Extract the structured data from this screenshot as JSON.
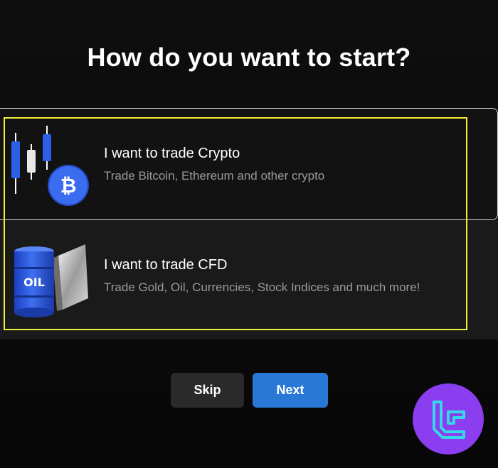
{
  "heading": "How do you want to start?",
  "options": [
    {
      "title": "I want to trade Crypto",
      "subtitle": "Trade Bitcoin, Ethereum and other crypto",
      "icon": "crypto-candles-bitcoin-icon"
    },
    {
      "title": "I want to trade CFD",
      "subtitle": "Trade Gold, Oil, Currencies, Stock Indices and much more!",
      "icon": "oil-barrel-silver-icon",
      "barrel_label": "OIL"
    }
  ],
  "buttons": {
    "skip_label": "Skip",
    "next_label": "Next"
  },
  "colors": {
    "accent_blue": "#2a78d6",
    "highlight_yellow": "#f3ee3a",
    "logo_purple": "#8b3df0",
    "logo_cyan": "#36d8e8"
  }
}
